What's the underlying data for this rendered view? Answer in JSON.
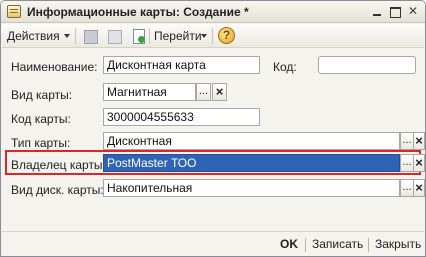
{
  "window": {
    "title": "Информационные карты: Создание *"
  },
  "toolbar": {
    "actions_label": "Действия",
    "goto_label": "Перейти",
    "help_glyph": "?"
  },
  "form": {
    "name_label": "Наименование:",
    "name_value": "Дисконтная карта",
    "code_label": "Код:",
    "code_value": "",
    "card_kind_label": "Вид карты:",
    "card_kind_value": "Магнитная",
    "card_code_label": "Код карты:",
    "card_code_value": "3000004555633",
    "card_type_label": "Тип карты:",
    "card_type_value": "Дисконтная",
    "owner_label": "Владелец карты:",
    "owner_value": "PostMaster ТОО",
    "discount_kind_label": "Вид диск. карты:",
    "discount_kind_value": "Накопительная"
  },
  "field_buttons": {
    "select": "...",
    "clear": "×"
  },
  "footer": {
    "ok_label": "OK",
    "save_label": "Записать",
    "close_label": "Закрыть"
  },
  "colors": {
    "highlight": "#e0242a",
    "selection": "#2f63b5"
  }
}
